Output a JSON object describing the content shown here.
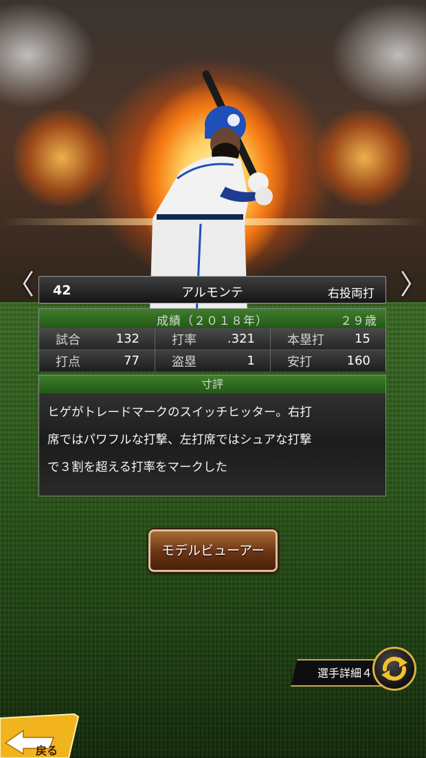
{
  "player": {
    "number": "42",
    "name": "アルモンテ",
    "throw_bat": "右投両打"
  },
  "stats": {
    "header_title": "成績（２０１８年）",
    "age": "２９歳",
    "rows": [
      [
        {
          "label": "試合",
          "value": "132"
        },
        {
          "label": "打率",
          "value": ".321"
        },
        {
          "label": "本塁打",
          "value": "15"
        }
      ],
      [
        {
          "label": "打点",
          "value": "77"
        },
        {
          "label": "盗塁",
          "value": "1"
        },
        {
          "label": "安打",
          "value": "160"
        }
      ]
    ]
  },
  "review": {
    "header": "寸評",
    "lines": [
      "ヒゲがトレードマークのスイッチヒッター。右打",
      "席ではパワフルな打撃、左打席ではシュアな打撃",
      "で３割を超える打率をマークした"
    ]
  },
  "buttons": {
    "model_viewer": "モデルビューアー",
    "player_detail": "選手詳細４",
    "back": "戻る"
  },
  "nav": {
    "prev": "〈",
    "next": "〉"
  },
  "colors": {
    "header_green": "#2f6a20",
    "button_brown": "#7a4018",
    "gold": "#d8b440",
    "back_yellow": "#f2b41e"
  },
  "icons": {
    "swap": "swap-arrows-icon",
    "back": "back-arrow-icon"
  }
}
